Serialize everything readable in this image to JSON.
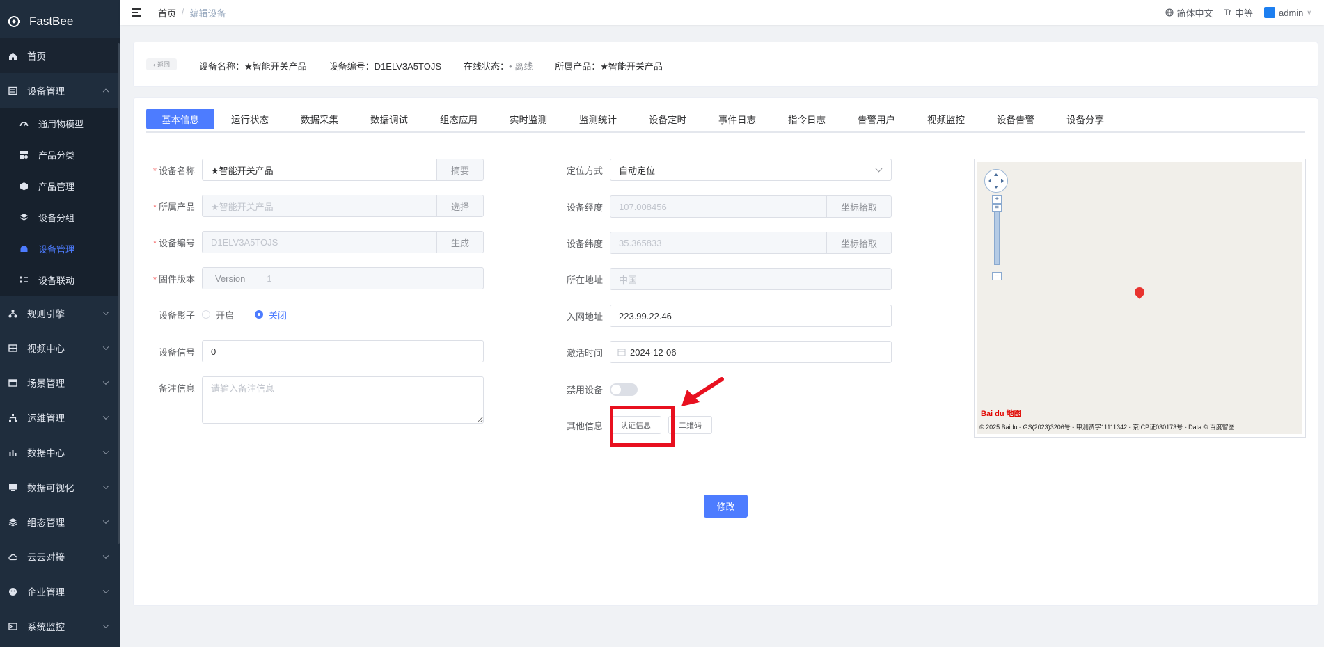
{
  "app": {
    "name": "FastBee"
  },
  "sidebar": {
    "home": "首页",
    "device_mgmt": "设备管理",
    "sub_items": [
      "通用物模型",
      "产品分类",
      "产品管理",
      "设备分组",
      "设备管理",
      "设备联动"
    ],
    "groups": [
      "规则引擎",
      "视频中心",
      "场景管理",
      "运维管理",
      "数据中心",
      "数据可视化",
      "组态管理",
      "云云对接",
      "企业管理",
      "系统监控"
    ]
  },
  "topbar": {
    "breadcrumb_home": "首页",
    "breadcrumb_sep": "/",
    "breadcrumb_current": "编辑设备",
    "lang": "简体中文",
    "font_size": "中等",
    "user": "admin"
  },
  "header": {
    "back_label": "返回",
    "device_name": "设备名称：★智能开关产品",
    "device_number": "设备编号：D1ELV3A5TOJS",
    "online_label": "在线状态：",
    "online_value": "• 离线",
    "product": "所属产品：★智能开关产品"
  },
  "tabs": [
    "基本信息",
    "运行状态",
    "数据采集",
    "数据调试",
    "组态应用",
    "实时监测",
    "监测统计",
    "设备定时",
    "事件日志",
    "指令日志",
    "告警用户",
    "视频监控",
    "设备告警",
    "设备分享"
  ],
  "form_left": {
    "name_label": "设备名称",
    "name_value": "★智能开关产品",
    "name_btn": "摘要",
    "product_label": "所属产品",
    "product_value": "★智能开关产品",
    "product_btn": "选择",
    "number_label": "设备编号",
    "number_value": "D1ELV3A5TOJS",
    "number_btn": "生成",
    "fw_label": "固件版本",
    "fw_prefix": "Version",
    "fw_value": "1",
    "shadow_label": "设备影子",
    "shadow_on": "开启",
    "shadow_off": "关闭",
    "signal_label": "设备信号",
    "signal_value": "0",
    "remark_label": "备注信息",
    "remark_placeholder": "请输入备注信息"
  },
  "form_right": {
    "loc_label": "定位方式",
    "loc_value": "自动定位",
    "lng_label": "设备经度",
    "lng_value": "107.008456",
    "lng_btn": "坐标拾取",
    "lat_label": "设备纬度",
    "lat_value": "35.365833",
    "lat_btn": "坐标拾取",
    "addr_label": "所在地址",
    "addr_value": "中国",
    "ip_label": "入网地址",
    "ip_value": "223.99.22.46",
    "act_label": "激活时间",
    "act_value": "2024-12-06",
    "disable_label": "禁用设备",
    "other_label": "其他信息",
    "auth_btn": "认证信息",
    "qr_btn": "二维码"
  },
  "submit": "修改",
  "map": {
    "logo": "Bai du 地图",
    "copyright": "© 2025 Baidu - GS(2023)3206号 - 甲测资字11111342 - 京ICP证030173号 - Data © 百度智图"
  },
  "colors": {
    "primary": "#4d7cff",
    "sidebar": "#1f2d3d",
    "annotation": "#e8101f"
  }
}
